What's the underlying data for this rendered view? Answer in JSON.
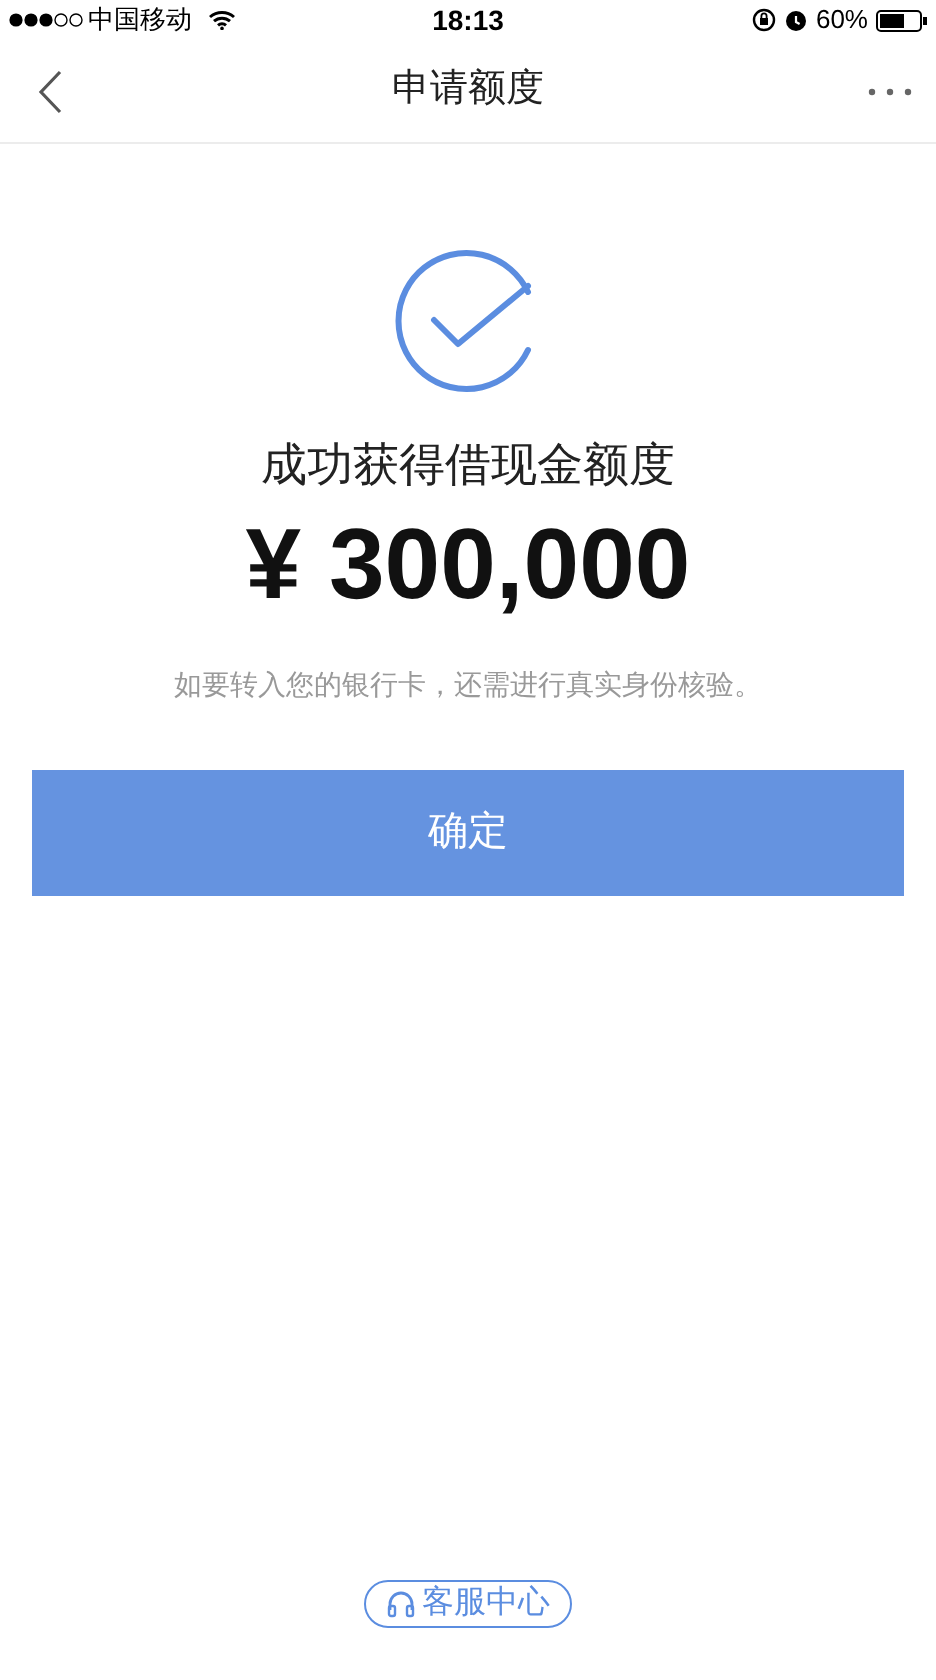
{
  "status_bar": {
    "carrier": "中国移动",
    "time": "18:13",
    "battery": "60%"
  },
  "nav": {
    "title": "申请额度"
  },
  "result": {
    "heading": "成功获得借现金额度",
    "amount": "¥ 300,000",
    "note": "如要转入您的银行卡，还需进行真实身份核验。"
  },
  "confirm_button": {
    "label": "确定"
  },
  "help_link": {
    "label": "客服中心"
  }
}
